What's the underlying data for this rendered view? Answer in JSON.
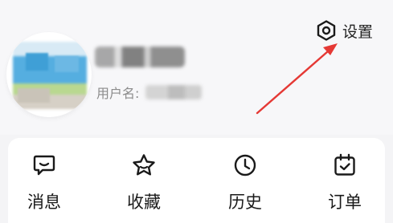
{
  "header": {
    "settings_label": "设置",
    "settings_icon": "gear-hexagon-icon",
    "username_label": "用户名:"
  },
  "quick_actions": [
    {
      "label": "消息",
      "icon": "message-icon"
    },
    {
      "label": "收藏",
      "icon": "star-icon"
    },
    {
      "label": "历史",
      "icon": "clock-icon"
    },
    {
      "label": "订单",
      "icon": "calendar-check-icon"
    }
  ],
  "colors": {
    "annotation_arrow": "#e53935",
    "icon_stroke": "#1a1a1a"
  }
}
